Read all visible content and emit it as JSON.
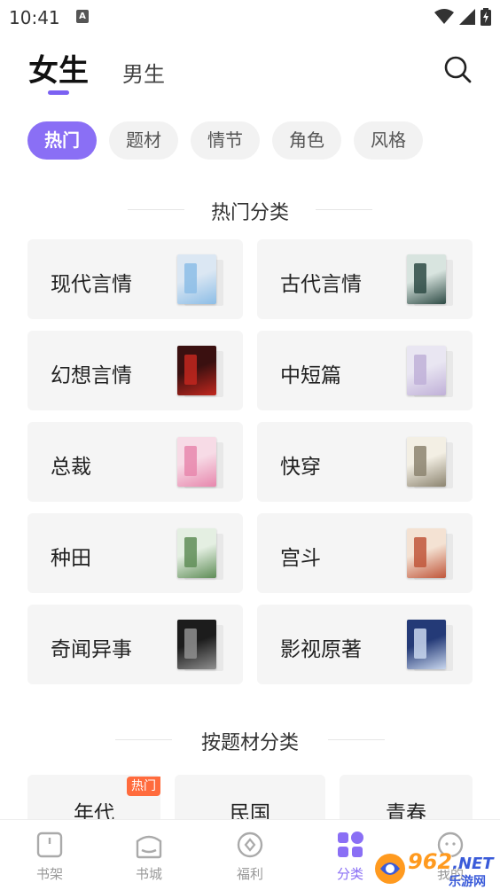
{
  "status_bar": {
    "time": "10:41",
    "notification_letter": "A"
  },
  "gender_tabs": {
    "active": "女生",
    "inactive": "男生"
  },
  "chips": [
    "热门",
    "题材",
    "情节",
    "角色",
    "风格"
  ],
  "hot_section": {
    "title": "热门分类",
    "categories": [
      {
        "label": "现代言情",
        "cover_color": "#dbe7f3",
        "cover_accent": "#8cbde6"
      },
      {
        "label": "古代言情",
        "cover_color": "#d8e4df",
        "cover_accent": "#2e4b45"
      },
      {
        "label": "幻想言情",
        "cover_color": "#3a1010",
        "cover_accent": "#c2271e"
      },
      {
        "label": "中短篇",
        "cover_color": "#e9e6f2",
        "cover_accent": "#c0b0d8"
      },
      {
        "label": "总裁",
        "cover_color": "#f7dbe6",
        "cover_accent": "#e787ad"
      },
      {
        "label": "快穿",
        "cover_color": "#f3efe4",
        "cover_accent": "#8c8470"
      },
      {
        "label": "种田",
        "cover_color": "#e4efe2",
        "cover_accent": "#5f8d57"
      },
      {
        "label": "宫斗",
        "cover_color": "#f4e2d3",
        "cover_accent": "#c0563a"
      },
      {
        "label": "奇闻异事",
        "cover_color": "#1c1c1c",
        "cover_accent": "#8f8f8f"
      },
      {
        "label": "影视原著",
        "cover_color": "#243a77",
        "cover_accent": "#c9d7ee"
      }
    ]
  },
  "subject_section": {
    "title": "按题材分类",
    "items": [
      {
        "label": "年代",
        "badge": "热门"
      },
      {
        "label": "民国"
      },
      {
        "label": "青春"
      }
    ]
  },
  "bottom_nav": [
    {
      "label": "书架",
      "icon": "bookshelf-icon"
    },
    {
      "label": "书城",
      "icon": "bookstore-icon"
    },
    {
      "label": "福利",
      "icon": "welfare-icon"
    },
    {
      "label": "分类",
      "icon": "category-icon",
      "active": true
    },
    {
      "label": "我的",
      "icon": "profile-icon"
    }
  ],
  "watermark": {
    "text": "962",
    "suffix": ".NET",
    "sub": "乐游网"
  },
  "colors": {
    "accent": "#8a6ff5",
    "badge": "#ff6b3d",
    "card_bg": "#f5f5f5",
    "chip_bg": "#f2f2f2"
  }
}
